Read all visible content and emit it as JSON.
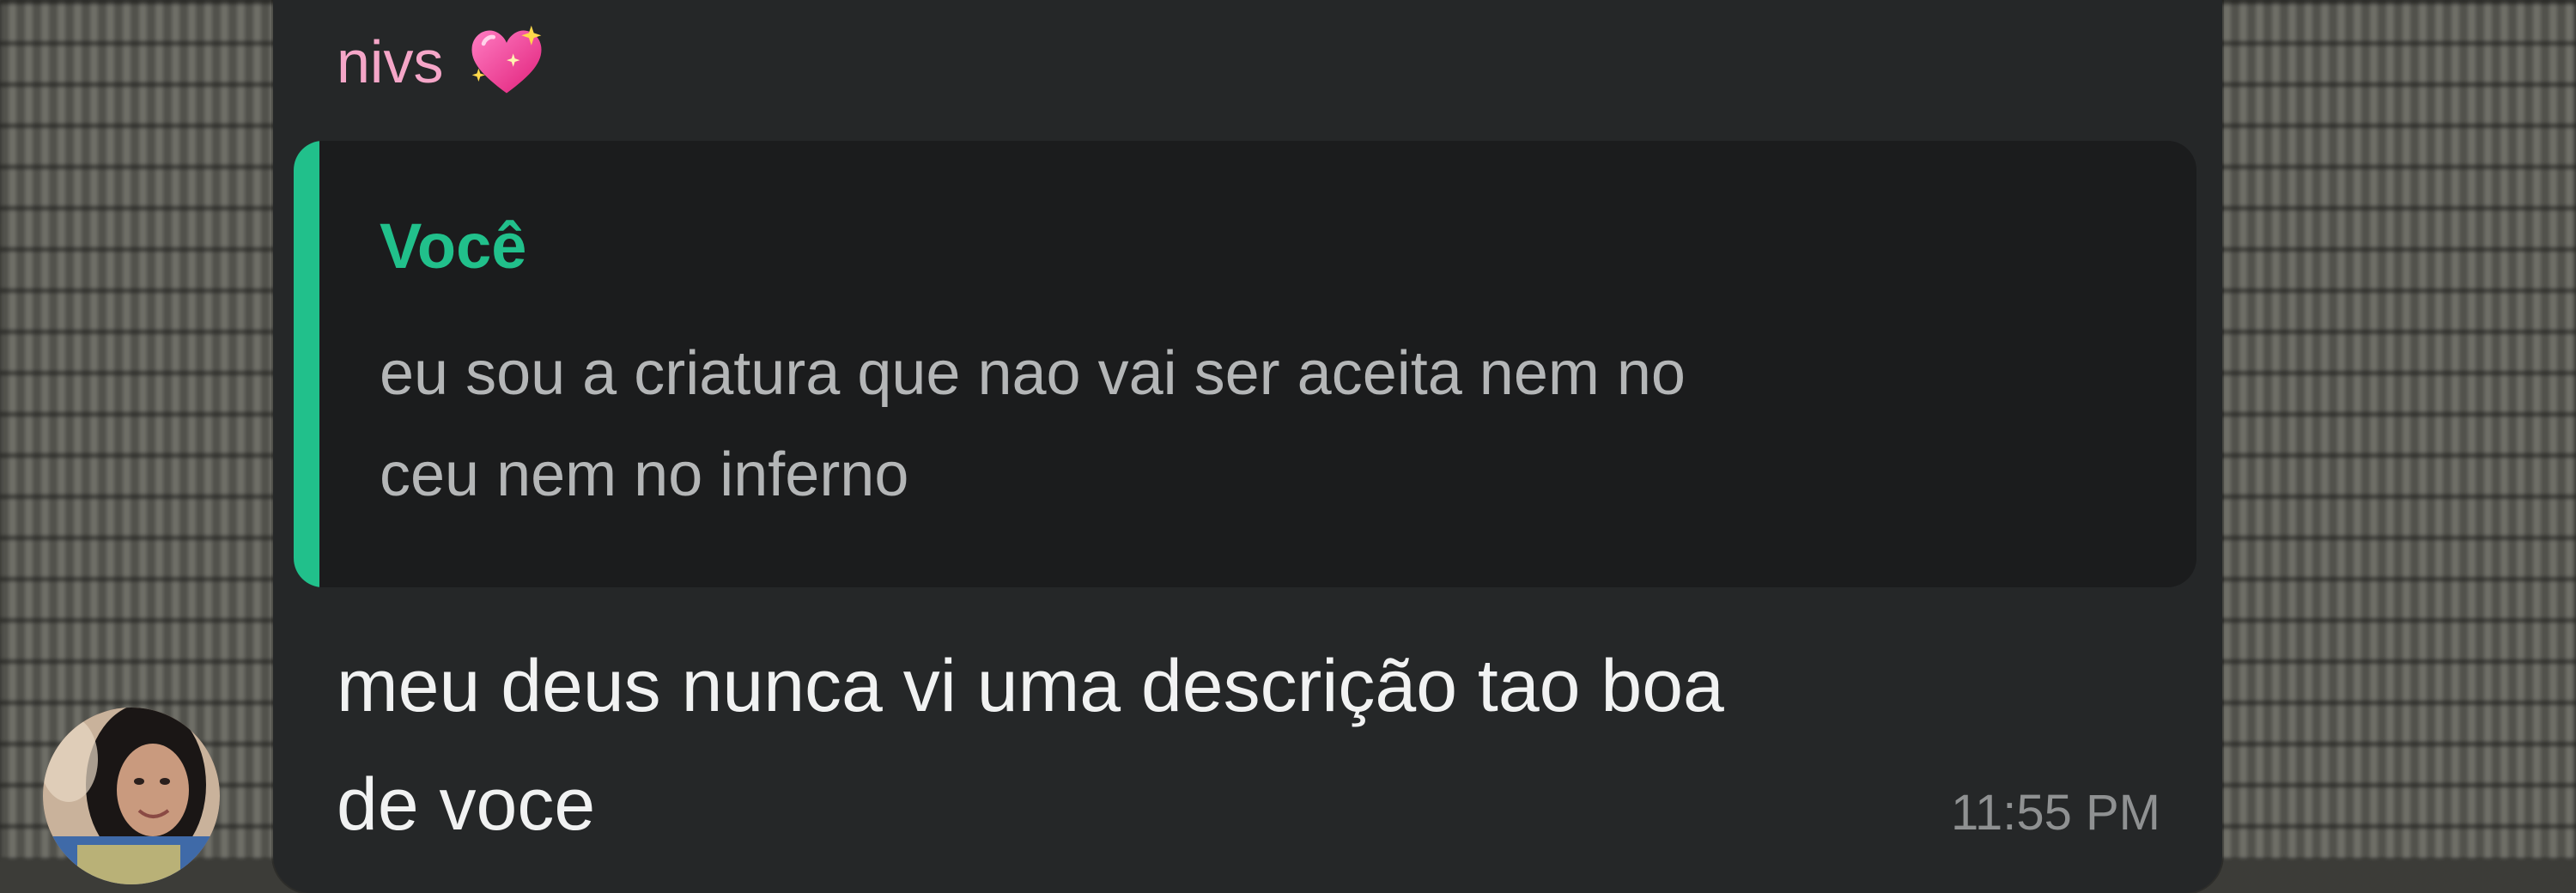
{
  "message": {
    "sender_name": "nivs",
    "sender_emoji": "sparkling-heart-emoji",
    "reply": {
      "author": "Você",
      "text": "eu sou a criatura que nao vai ser aceita nem no\nceu nem no inferno"
    },
    "text": "meu deus nunca vi uma descrição tao boa\nde voce",
    "time": "11:55 PM"
  },
  "colors": {
    "bubble_bg": "#252728",
    "quote_bg": "#1b1c1d",
    "quote_accent": "#21c08b",
    "sender_name": "#f5a6c8",
    "message_text": "#f1f2f2",
    "quote_text": "#b4b6b7",
    "timestamp": "#8f9192"
  }
}
